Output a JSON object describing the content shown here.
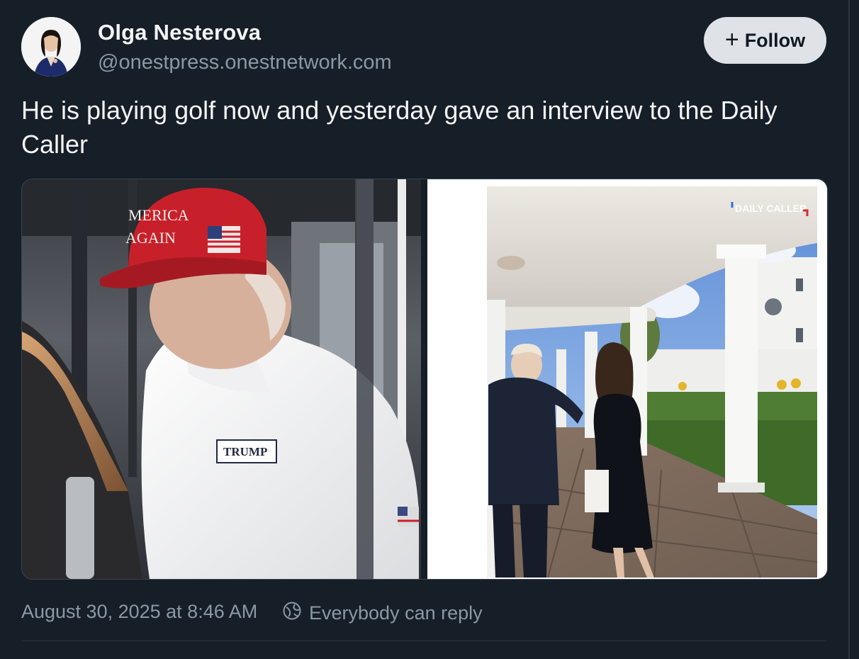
{
  "post": {
    "author_name": "Olga Nesterova",
    "author_handle": "@onestpress.onestnetwork.com",
    "follow_label": "Follow",
    "text": "He is playing golf now and yesterday gave an interview to the Daily Caller",
    "timestamp": "August 30, 2025 at 8:46 AM",
    "reply_setting": "Everybody can reply"
  },
  "media": {
    "left": {
      "cap_text_line1": "MERICA",
      "cap_text_line2": "AGAIN",
      "shirt_logo": "TRUMP"
    },
    "right": {
      "watermark": "DAILY CALLER"
    }
  },
  "colors": {
    "background": "#161e27",
    "follow_button": "#dfe3e8",
    "secondary_text": "#8b98a6",
    "cap_red": "#c8202a"
  },
  "icons": {
    "follow": "plus-icon",
    "reply": "globe-icon"
  }
}
